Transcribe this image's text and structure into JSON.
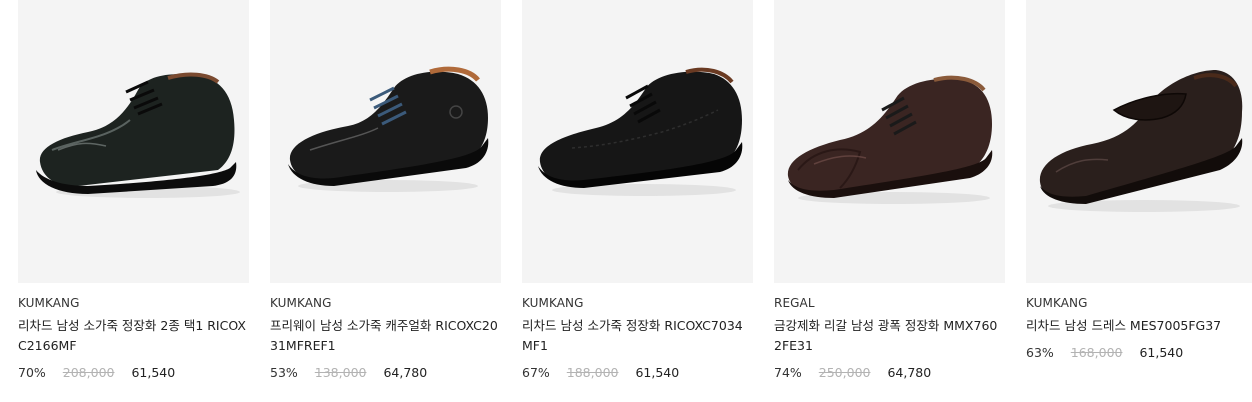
{
  "products": [
    {
      "brand": "KUMKANG",
      "name": "리차드 남성 소가죽 정장화 2종 택1 RICOXC2166MF",
      "discount": "70%",
      "original_price": "208,000",
      "sale_price": "61,540",
      "shoe_color": "#1d2320",
      "image_icon": "derby-shoe-icon"
    },
    {
      "brand": "KUMKANG",
      "name": "프리웨이 남성 소가죽 캐주얼화 RICOXC2031MFREF1",
      "discount": "53%",
      "original_price": "138,000",
      "sale_price": "64,780",
      "shoe_color": "#1a1a1a",
      "image_icon": "casual-shoe-icon"
    },
    {
      "brand": "KUMKANG",
      "name": "리차드 남성 소가죽 정장화 RICOXC7034MF1",
      "discount": "67%",
      "original_price": "188,000",
      "sale_price": "61,540",
      "shoe_color": "#161616",
      "image_icon": "dress-shoe-icon"
    },
    {
      "brand": "REGAL",
      "name": "금강제화 리갈 남성 광폭 정장화 MMX7602FE31",
      "discount": "74%",
      "original_price": "250,000",
      "sale_price": "64,780",
      "shoe_color": "#3a2522",
      "image_icon": "cap-toe-shoe-icon"
    },
    {
      "brand": "KUMKANG",
      "name": "리차드 남성 드레스 MES7005FG37",
      "discount": "63%",
      "original_price": "168,000",
      "sale_price": "61,540",
      "shoe_color": "#2a1f1c",
      "image_icon": "loafer-icon"
    }
  ]
}
